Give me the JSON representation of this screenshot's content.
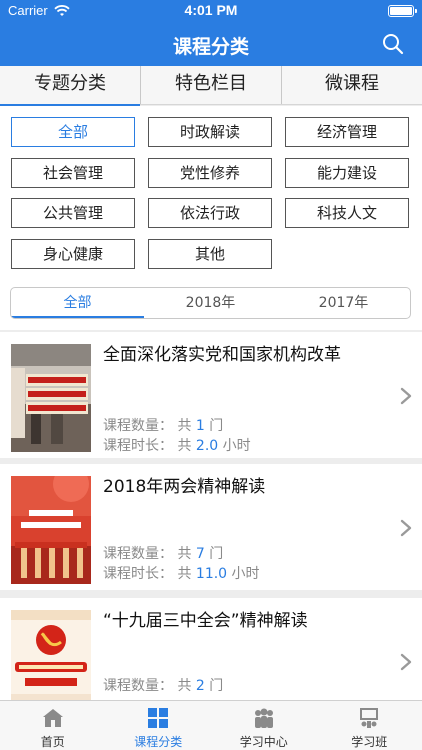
{
  "status": {
    "carrier": "Carrier",
    "time": "4:01 PM"
  },
  "nav": {
    "title": "课程分类"
  },
  "tabs": [
    {
      "label": "专题分类",
      "active": true
    },
    {
      "label": "特色栏目",
      "active": false
    },
    {
      "label": "微课程",
      "active": false
    }
  ],
  "categories": [
    "全部",
    "时政解读",
    "经济管理",
    "社会管理",
    "党性修养",
    "能力建设",
    "公共管理",
    "依法行政",
    "科技人文",
    "身心健康",
    "其他"
  ],
  "years": [
    "全部",
    "2018年",
    "2017年"
  ],
  "labels": {
    "count": "课程数量：",
    "duration": "课程时长：",
    "total": "共",
    "unit_count": "门",
    "unit_hour": "小时"
  },
  "courses": [
    {
      "title": "全面深化落实党和国家机构改革",
      "count": "1",
      "duration": "2.0",
      "thumb_text": "全面深化落实党和国家机构改革"
    },
    {
      "title": "2018年两会精神解读",
      "count": "7",
      "duration": "11.0",
      "thumb_text": "2018年两会精神解读"
    },
    {
      "title": "“十九届三中全会”精神解读",
      "count": "2",
      "duration": "",
      "thumb_text": "“十九届三中全会”精神解读"
    }
  ],
  "tabbar": [
    {
      "label": "首页",
      "icon": "home-icon",
      "active": false
    },
    {
      "label": "课程分类",
      "icon": "grid-icon",
      "active": true
    },
    {
      "label": "学习中心",
      "icon": "people-icon",
      "active": false
    },
    {
      "label": "学习班",
      "icon": "class-icon",
      "active": false
    }
  ],
  "colors": {
    "brand": "#2a7de1",
    "muted": "#8a8a8a"
  }
}
